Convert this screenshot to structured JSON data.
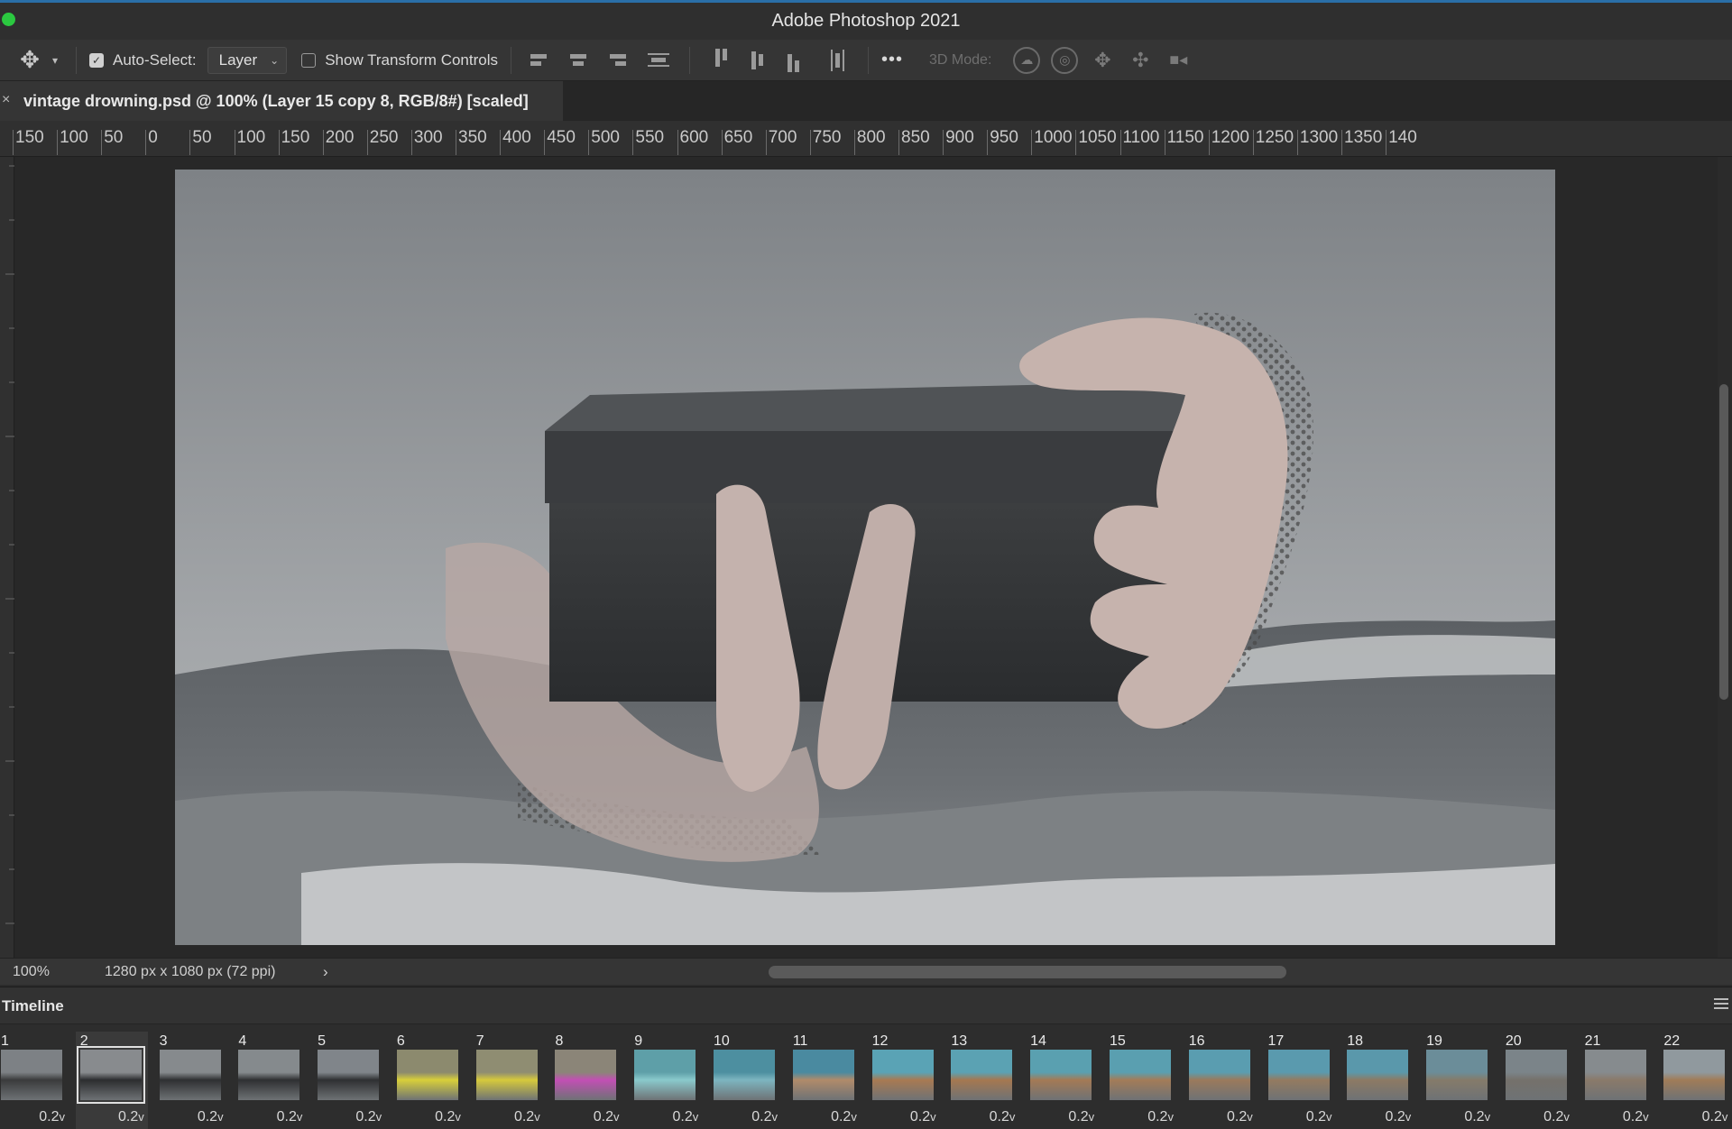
{
  "app": {
    "title": "Adobe Photoshop 2021"
  },
  "options_bar": {
    "auto_select_label": "Auto-Select:",
    "auto_select_checked": true,
    "auto_select_target": "Layer",
    "show_transform_label": "Show Transform Controls",
    "show_transform_checked": false,
    "more_label": "•••",
    "mode_3d_label": "3D Mode:"
  },
  "document": {
    "tab_title": "vintage drowning.psd @ 100% (Layer 15 copy 8, RGB/8#) [scaled]",
    "close_glyph": "×"
  },
  "ruler": {
    "labels": [
      "150",
      "100",
      "50",
      "0",
      "50",
      "100",
      "150",
      "200",
      "250",
      "300",
      "350",
      "400",
      "450",
      "500",
      "550",
      "600",
      "650",
      "700",
      "750",
      "800",
      "850",
      "900",
      "950",
      "1000",
      "1050",
      "1100",
      "1150",
      "1200",
      "1250",
      "1300",
      "1350",
      "140"
    ]
  },
  "status": {
    "zoom": "100%",
    "doc_info": "1280 px x 1080 px (72 ppi)",
    "arrow": "›"
  },
  "timeline": {
    "label": "Timeline",
    "selected_frame": "2",
    "frames": [
      {
        "num": "1",
        "dur": "0.2",
        "caret": "v"
      },
      {
        "num": "2",
        "dur": "0.2",
        "caret": "v"
      },
      {
        "num": "3",
        "dur": "0.2",
        "caret": "v"
      },
      {
        "num": "4",
        "dur": "0.2",
        "caret": "v"
      },
      {
        "num": "5",
        "dur": "0.2",
        "caret": "v"
      },
      {
        "num": "6",
        "dur": "0.2",
        "caret": "v"
      },
      {
        "num": "7",
        "dur": "0.2",
        "caret": "v"
      },
      {
        "num": "8",
        "dur": "0.2",
        "caret": "v"
      },
      {
        "num": "9",
        "dur": "0.2",
        "caret": "v"
      },
      {
        "num": "10",
        "dur": "0.2",
        "caret": "v"
      },
      {
        "num": "11",
        "dur": "0.2",
        "caret": "v"
      },
      {
        "num": "12",
        "dur": "0.2",
        "caret": "v"
      },
      {
        "num": "13",
        "dur": "0.2",
        "caret": "v"
      },
      {
        "num": "14",
        "dur": "0.2",
        "caret": "v"
      },
      {
        "num": "15",
        "dur": "0.2",
        "caret": "v"
      },
      {
        "num": "16",
        "dur": "0.2",
        "caret": "v"
      },
      {
        "num": "17",
        "dur": "0.2",
        "caret": "v"
      },
      {
        "num": "18",
        "dur": "0.2",
        "caret": "v"
      },
      {
        "num": "19",
        "dur": "0.2",
        "caret": "v"
      },
      {
        "num": "20",
        "dur": "0.2",
        "caret": "v"
      },
      {
        "num": "21",
        "dur": "0.2",
        "caret": "v"
      },
      {
        "num": "22",
        "dur": "0.2",
        "caret": "v"
      }
    ]
  }
}
